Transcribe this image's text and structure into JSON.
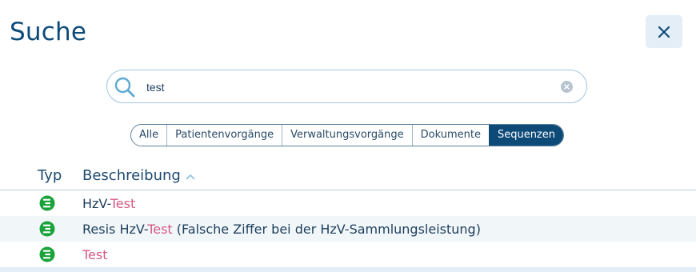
{
  "header": {
    "title": "Suche"
  },
  "colors": {
    "brand": "#0e4a78",
    "highlight": "#d65a86",
    "sequence_icon": "#1aa33a"
  },
  "close_button": {
    "icon": "close-icon"
  },
  "search": {
    "value": "test",
    "icon": "search-icon",
    "clear_icon": "clear-icon"
  },
  "filters": {
    "tabs": [
      {
        "label": "Alle",
        "active": false
      },
      {
        "label": "Patientenvorgänge",
        "active": false
      },
      {
        "label": "Verwaltungsvorgänge",
        "active": false
      },
      {
        "label": "Dokumente",
        "active": false
      },
      {
        "label": "Sequenzen",
        "active": true
      }
    ]
  },
  "table": {
    "headers": {
      "type": "Typ",
      "description": "Beschreibung"
    },
    "sort": "ascending",
    "rows": [
      {
        "icon": "sequence-icon",
        "pre": "HzV-",
        "match": "Test",
        "post": ""
      },
      {
        "icon": "sequence-icon",
        "pre": "Resis HzV-",
        "match": "Test",
        "post": " (Falsche Ziffer bei der HzV-Sammlungsleistung)"
      },
      {
        "icon": "sequence-icon",
        "pre": "",
        "match": "Test",
        "post": ""
      }
    ]
  }
}
